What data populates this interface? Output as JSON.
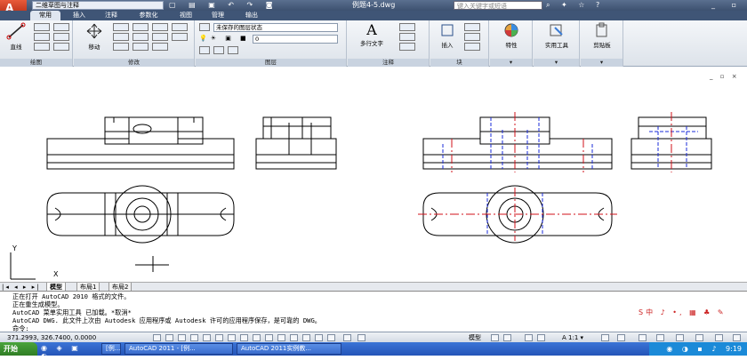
{
  "titlebar": {
    "workspace": "二维草图与注释",
    "document_title": "例题4-5.dwg",
    "help_placeholder": "键入关键字或短语"
  },
  "ribbon_tabs": [
    "常用",
    "插入",
    "注释",
    "参数化",
    "视图",
    "管理",
    "输出"
  ],
  "ribbon": {
    "draw": {
      "label": "绘图",
      "line_label": "直线"
    },
    "modify": {
      "label": "修改",
      "move_label": "移动"
    },
    "layers": {
      "label": "图层",
      "state_value": "未保存的图层状态",
      "current_layer": "0"
    },
    "annotation": {
      "label": "注释",
      "mtext_label": "多行文字"
    },
    "block": {
      "label": "块",
      "insert_label": "插入"
    },
    "properties": {
      "label": "特性"
    },
    "utilities": {
      "label": "实用工具"
    },
    "clipboard": {
      "label": "剪贴板"
    }
  },
  "viewport_controls": "_ ▫ ×",
  "ucs": {
    "x_label": "X",
    "y_label": "Y"
  },
  "layout_tabs": [
    "模型",
    "布局1",
    "布局2"
  ],
  "command_lines": [
    "正在打开 AutoCAD 2010 格式的文件。",
    "正在重生成模型。",
    "AutoCAD 菜单实用工具 已加载。*取消*",
    "AutoCAD DWG.   此文件上次由 Autodesk 应用程序或 Autodesk 许可的应用程序保存，是可靠的 DWG。",
    "命令:"
  ],
  "ime_bar": "S中 ♪ •, ▦ ♣ ✎",
  "status": {
    "coordinates": "371.2993, 326.7400, 0.0000",
    "model_label": "模型",
    "scale": "A 1:1 ▾"
  },
  "taskbar": {
    "start_label": "开始",
    "items": [
      "[例...",
      "AutoCAD 2011 - [例...",
      "AutoCAD 2011实例教..."
    ],
    "clock": "9:19"
  },
  "colors": {
    "centerline": "#d0101a",
    "hidden": "#1a2bd8",
    "title_bg": "#3f5576",
    "taskbar": "#2454b8"
  }
}
